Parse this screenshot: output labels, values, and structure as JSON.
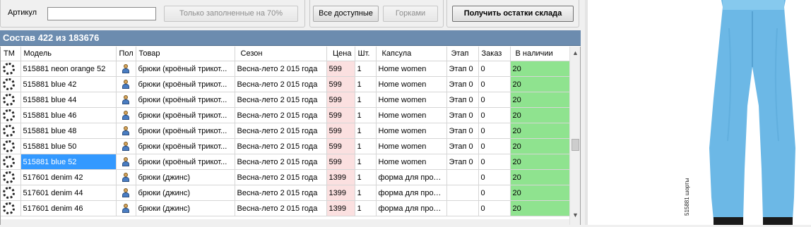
{
  "toolbar": {
    "article_label": "Артикул",
    "article_value": "",
    "filled_button": "Только заполненные на 70%",
    "all_available_button": "Все доступные",
    "gorki_button": "Горками",
    "get_stock_button": "Получить остатки склада"
  },
  "composition_header": "Состав 422 из 183676",
  "columns": [
    "ТМ",
    "Модель",
    "Пол",
    "Товар",
    "Сезон",
    "Цена",
    "Шт.",
    "Капсула",
    "Этап",
    "Заказ",
    "В наличии"
  ],
  "rows": [
    {
      "model": "515881 neon orange  52",
      "product": "брюки (кроёный трикот...",
      "season": "Весна-лето 2 015 года",
      "price": "599",
      "qty": "1",
      "capsule": "Home women",
      "stage": "Этап 0",
      "order": "0",
      "stock": "20"
    },
    {
      "model": "515881 blue  42",
      "product": "брюки (кроёный трикот...",
      "season": "Весна-лето 2 015 года",
      "price": "599",
      "qty": "1",
      "capsule": "Home women",
      "stage": "Этап 0",
      "order": "0",
      "stock": "20"
    },
    {
      "model": "515881 blue  44",
      "product": "брюки (кроёный трикот...",
      "season": "Весна-лето 2 015 года",
      "price": "599",
      "qty": "1",
      "capsule": "Home women",
      "stage": "Этап 0",
      "order": "0",
      "stock": "20"
    },
    {
      "model": "515881 blue  46",
      "product": "брюки (кроёный трикот...",
      "season": "Весна-лето 2 015 года",
      "price": "599",
      "qty": "1",
      "capsule": "Home women",
      "stage": "Этап 0",
      "order": "0",
      "stock": "20"
    },
    {
      "model": "515881 blue  48",
      "product": "брюки (кроёный трикот...",
      "season": "Весна-лето 2 015 года",
      "price": "599",
      "qty": "1",
      "capsule": "Home women",
      "stage": "Этап 0",
      "order": "0",
      "stock": "20"
    },
    {
      "model": "515881 blue  50",
      "product": "брюки (кроёный трикот...",
      "season": "Весна-лето 2 015 года",
      "price": "599",
      "qty": "1",
      "capsule": "Home women",
      "stage": "Этап 0",
      "order": "0",
      "stock": "20"
    },
    {
      "model": "515881 blue  52",
      "product": "брюки (кроёный трикот...",
      "season": "Весна-лето 2 015 года",
      "price": "599",
      "qty": "1",
      "capsule": "Home women",
      "stage": "Этап 0",
      "order": "0",
      "stock": "20",
      "selected": true
    },
    {
      "model": "517601 denim  42",
      "product": "брюки (джинс)",
      "season": "Весна-лето 2 015 года",
      "price": "1399",
      "qty": "1",
      "capsule": "форма для прод...",
      "stage": "",
      "order": "0",
      "stock": "20"
    },
    {
      "model": "517601 denim  44",
      "product": "брюки (джинс)",
      "season": "Весна-лето 2 015 года",
      "price": "1399",
      "qty": "1",
      "capsule": "форма для прод...",
      "stage": "",
      "order": "0",
      "stock": "20"
    },
    {
      "model": "517601 denim  46",
      "product": "брюки (джинс)",
      "season": "Весна-лето 2 015 года",
      "price": "1399",
      "qty": "1",
      "capsule": "форма для прод...",
      "stage": "",
      "order": "0",
      "stock": "20"
    }
  ],
  "photo_caption": "515881 шорты",
  "colors": {
    "header_bar": "#6c8caf",
    "stock_green": "#8fe38f",
    "price_pink": "#fbe0e0",
    "selection": "#3399ff",
    "pants_blue": "#6cb8e6"
  }
}
